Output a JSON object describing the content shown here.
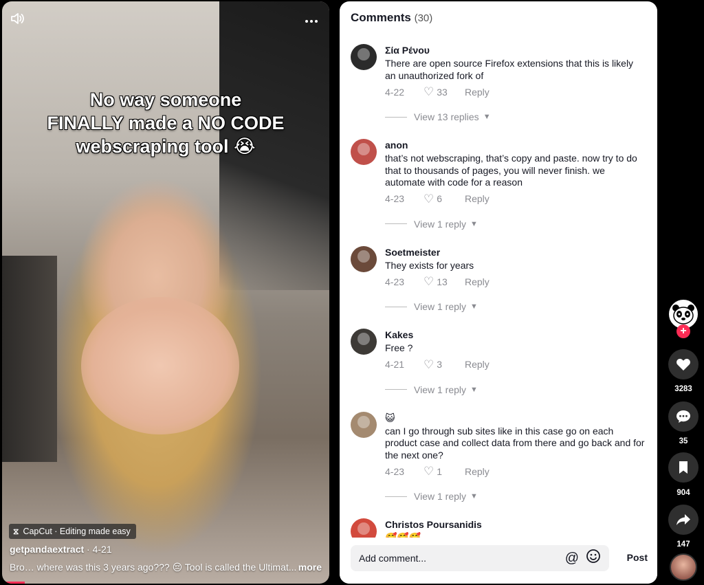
{
  "video": {
    "caption_lines": [
      "No way someone",
      "FINALLY made a NO CODE",
      "webscraping tool 😭"
    ],
    "badge": "CapCut · Editing made easy",
    "author": "getpandaextract",
    "date": "4-21",
    "description": "Bro… where was this 3 years ago??? 😔  Tool is called the Ultimat...",
    "more_label": "more",
    "icons": {
      "sound": "volume-icon",
      "menu": "more-icon"
    }
  },
  "comments": {
    "title": "Comments",
    "count": "(30)",
    "items": [
      {
        "avatar_color": "#2b2b2b",
        "name": "Σία Ρένου",
        "text": "There are open source Firefox extensions that this is likely an unauthorized fork of",
        "date": "4-22",
        "likes": "33",
        "reply": "Reply",
        "view_replies": "View 13 replies"
      },
      {
        "avatar_color": "#c0504a",
        "name": "anon",
        "text": "that’s not webscraping, that’s copy and paste. now try to do that to thousands of pages, you will never finish. we automate with code for a reason",
        "date": "4-23",
        "likes": "6",
        "reply": "Reply",
        "view_replies": "View 1 reply"
      },
      {
        "avatar_color": "#6b4a3a",
        "name": "Soetmeister",
        "text": "They exists for years",
        "date": "4-23",
        "likes": "13",
        "reply": "Reply",
        "view_replies": "View 1 reply"
      },
      {
        "avatar_color": "#3d3a36",
        "name": "Kakes",
        "text": "Free ?",
        "date": "4-21",
        "likes": "3",
        "reply": "Reply",
        "view_replies": "View 1 reply"
      },
      {
        "avatar_color": "#a48a70",
        "name": "😺",
        "text": "can I go through sub sites like in this case go on each product case and collect data from there and go back and for the next one?",
        "date": "4-23",
        "likes": "1",
        "reply": "Reply",
        "view_replies": "View 1 reply"
      },
      {
        "avatar_color": "#d24a3d",
        "name": "Christos Poursanidis",
        "text": "🥰🥰🥰"
      }
    ],
    "input_placeholder": "Add comment...",
    "post_label": "Post"
  },
  "rail": {
    "like_count": "3283",
    "comment_count": "35",
    "save_count": "904",
    "share_count": "147"
  }
}
